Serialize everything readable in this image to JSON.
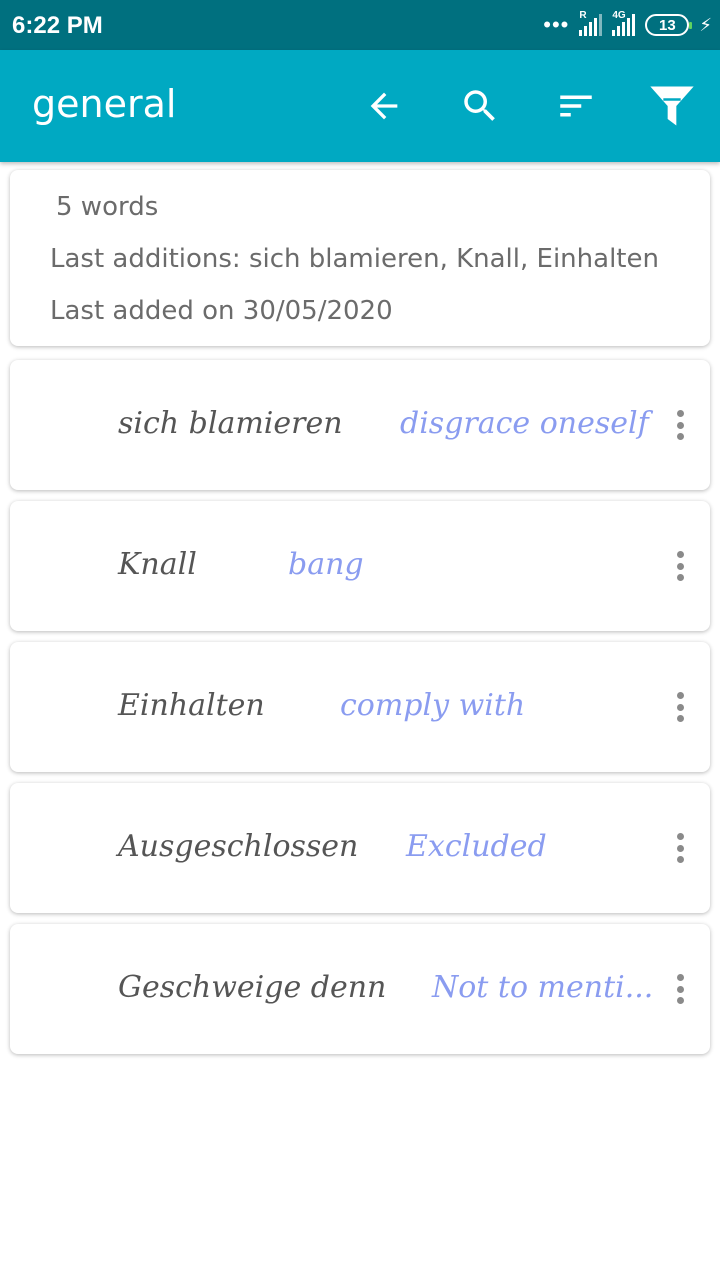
{
  "status_bar": {
    "time": "6:22 PM",
    "signal1_label": "R",
    "signal2_label": "4G",
    "battery": "13"
  },
  "app_bar": {
    "title": "general",
    "actions": [
      "back-arrow-icon",
      "search-icon",
      "sort-icon",
      "filter-icon"
    ]
  },
  "summary": {
    "count": "5 words",
    "last_additions": "Last additions: sich blamieren, Knall, Einhalten",
    "last_added": "Last added on 30/05/2020"
  },
  "words": [
    {
      "term": "sich blamieren",
      "translation": "disgrace oneself"
    },
    {
      "term": "Knall",
      "translation": "bang"
    },
    {
      "term": "Einhalten",
      "translation": "comply with"
    },
    {
      "term": "Ausgeschlossen",
      "translation": "Excluded"
    },
    {
      "term": "Geschweige denn",
      "translation": "Not to menti..."
    }
  ],
  "colors": {
    "status_bar": "#00707f",
    "app_bar": "#00a9c2",
    "term": "#555555",
    "translation": "#8a9cf0"
  }
}
